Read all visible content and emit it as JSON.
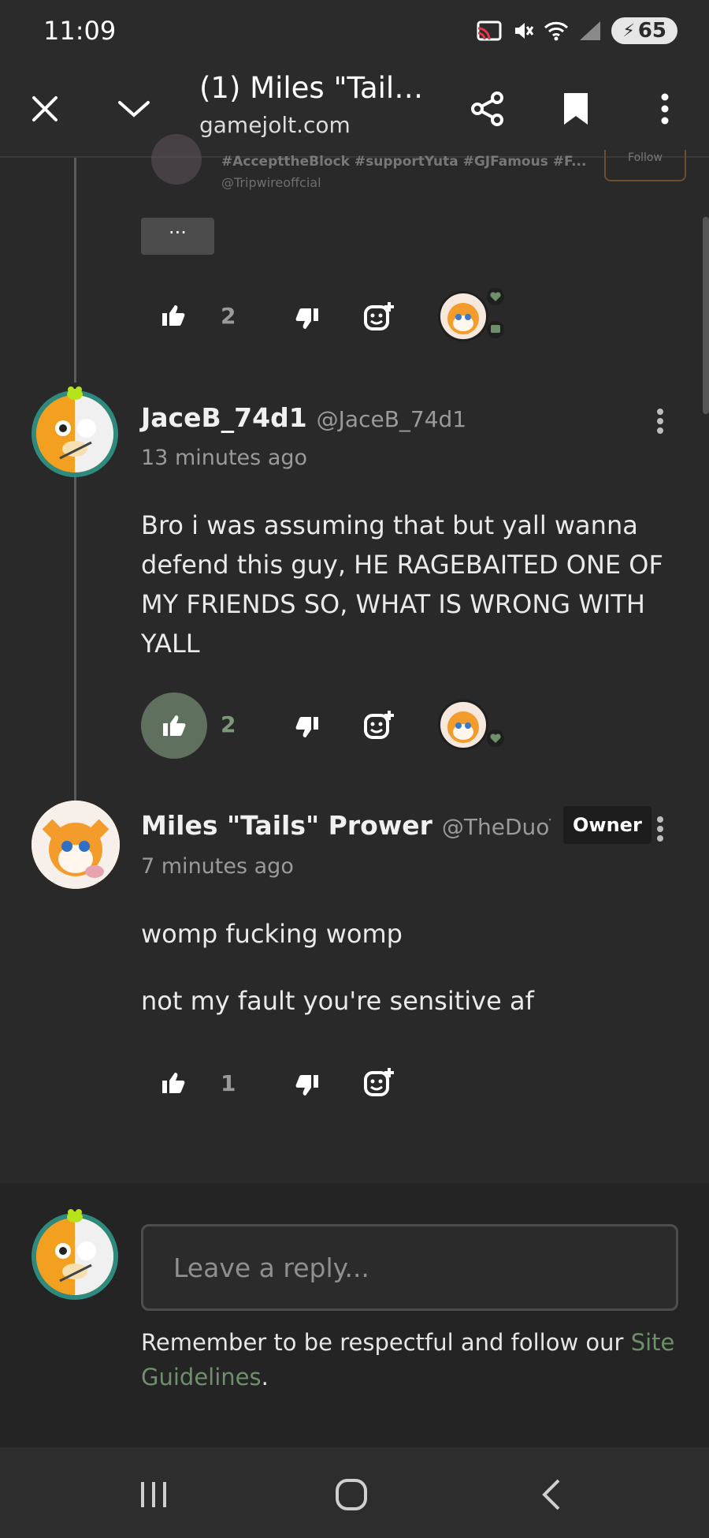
{
  "status_bar": {
    "time": "11:09",
    "battery": "65",
    "icons": [
      "cast-icon",
      "mute-icon",
      "wifi-icon",
      "signal-icon",
      "battery-icon"
    ]
  },
  "toolbar": {
    "title": "(1) Miles \"Tails...",
    "domain": "gamejolt.com",
    "icons": [
      "close-icon",
      "chevron-down-icon",
      "share-icon",
      "bookmark-icon",
      "more-vert-icon"
    ]
  },
  "top_post": {
    "tags": "#AccepttheBlock #supportYuta #GJFamous #F...",
    "handle": "@Tripwireoffcial",
    "follow_label": "Follow",
    "more_label": "···",
    "likes": "2"
  },
  "comments": [
    {
      "username": "JaceB_74d1",
      "handle": "@JaceB_74d1",
      "time": "13 minutes ago",
      "body": "Bro i was assuming that but yall wanna defend this guy, HE RAGEBAITED ONE OF MY FRIENDS SO, WHAT IS WRONG WITH YALL",
      "likes": "2",
      "liked": true
    },
    {
      "username": "Miles \"Tails\" Prower",
      "handle": "@TheDuoT...",
      "badge": "Owner",
      "time": "7 minutes ago",
      "body_lines": [
        "womp fucking womp",
        "not my fault you're sensitive af"
      ],
      "likes": "1",
      "liked": false
    }
  ],
  "reply": {
    "placeholder": "Leave a reply...",
    "rules_prefix": "Remember to be respectful and follow our ",
    "rules_link": "Site Guidelines",
    "rules_suffix": "."
  },
  "colors": {
    "background": "#292929",
    "accent_green": "#6f8f6c",
    "liked_bg": "#60705f",
    "avatar_ring": "#2e8a7f"
  }
}
